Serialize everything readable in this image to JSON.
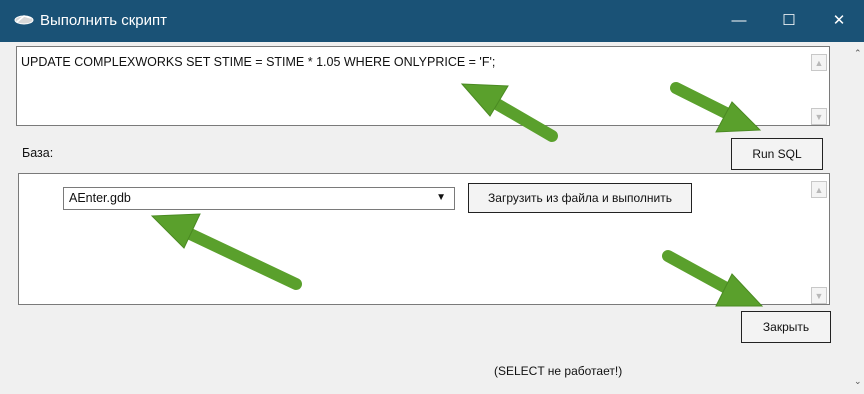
{
  "window": {
    "title": "Выполнить скрипт"
  },
  "sql": {
    "value": "UPDATE COMPLEXWORKS SET STIME = STIME * 1.05 WHERE ONLYPRICE = 'F';"
  },
  "database": {
    "label": "База:",
    "selected": "AEnter.gdb"
  },
  "buttons": {
    "run_sql": "Run SQL",
    "load_from_file": "Загрузить из файла и выполнить",
    "close": "Закрыть"
  },
  "footer": {
    "note": "(SELECT не работает!)"
  },
  "annotation_color": "#5aa02c"
}
